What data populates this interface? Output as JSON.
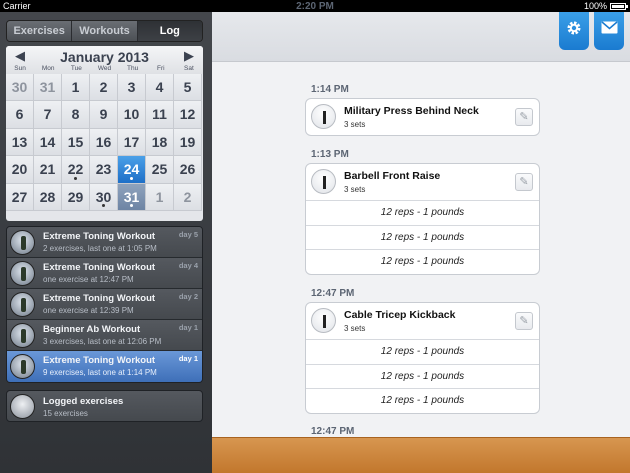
{
  "status": {
    "carrier": "Carrier",
    "time": "2:20 PM",
    "battery": "100%"
  },
  "tabs": [
    {
      "label": "Exercises",
      "active": false
    },
    {
      "label": "Workouts",
      "active": false
    },
    {
      "label": "Log",
      "active": true
    }
  ],
  "calendar": {
    "month": "January 2013",
    "prev": "◀",
    "next": "▶",
    "dows": [
      "Sun",
      "Mon",
      "Tue",
      "Wed",
      "Thu",
      "Fri",
      "Sat"
    ],
    "weeks": [
      [
        {
          "d": "30",
          "other": true
        },
        {
          "d": "31",
          "other": true
        },
        {
          "d": "1"
        },
        {
          "d": "2"
        },
        {
          "d": "3"
        },
        {
          "d": "4"
        },
        {
          "d": "5"
        }
      ],
      [
        {
          "d": "6"
        },
        {
          "d": "7"
        },
        {
          "d": "8"
        },
        {
          "d": "9"
        },
        {
          "d": "10"
        },
        {
          "d": "11"
        },
        {
          "d": "12"
        }
      ],
      [
        {
          "d": "13"
        },
        {
          "d": "14"
        },
        {
          "d": "15"
        },
        {
          "d": "16"
        },
        {
          "d": "17"
        },
        {
          "d": "18"
        },
        {
          "d": "19"
        }
      ],
      [
        {
          "d": "20"
        },
        {
          "d": "21"
        },
        {
          "d": "22",
          "dot": true
        },
        {
          "d": "23"
        },
        {
          "d": "24",
          "dot": true,
          "selected": true
        },
        {
          "d": "25"
        },
        {
          "d": "26"
        }
      ],
      [
        {
          "d": "27"
        },
        {
          "d": "28"
        },
        {
          "d": "29"
        },
        {
          "d": "30",
          "dot": true
        },
        {
          "d": "31",
          "dot": true,
          "today": true
        },
        {
          "d": "1",
          "other": true
        },
        {
          "d": "2",
          "other": true
        }
      ]
    ]
  },
  "workouts": [
    {
      "title": "Extreme Toning Workout",
      "sub": "2 exercises, last one at 1:05 PM",
      "day": "day 5",
      "active": false
    },
    {
      "title": "Extreme Toning Workout",
      "sub": "one exercise at 12:47 PM",
      "day": "day 4",
      "active": false
    },
    {
      "title": "Extreme Toning Workout",
      "sub": "one exercise at 12:39 PM",
      "day": "day 2",
      "active": false
    },
    {
      "title": "Beginner Ab Workout",
      "sub": "3 exercises, last one at 12:06 PM",
      "day": "day 1",
      "active": false
    },
    {
      "title": "Extreme Toning Workout",
      "sub": "9 exercises, last one at 1:14 PM",
      "day": "day 1",
      "active": true
    }
  ],
  "logged": {
    "title": "Logged exercises",
    "sub": "15 exercises"
  },
  "entries": [
    {
      "time": "1:14 PM",
      "name": "Military Press Behind Neck",
      "sets": "3 sets",
      "rows": []
    },
    {
      "time": "1:13 PM",
      "name": "Barbell Front Raise",
      "sets": "3 sets",
      "rows": [
        "12 reps - 1 pounds",
        "12 reps - 1 pounds",
        "12 reps - 1 pounds"
      ]
    },
    {
      "time": "12:47 PM",
      "name": "Cable Tricep Kickback",
      "sets": "3 sets",
      "rows": [
        "12 reps - 1 pounds",
        "12 reps - 1 pounds",
        "12 reps - 1 pounds"
      ]
    },
    {
      "time": "12:47 PM",
      "name": "",
      "sets": "",
      "rows": []
    }
  ],
  "icons": {
    "settings": "gear-icon",
    "mail": "mail-icon",
    "edit": "pencil-icon"
  },
  "colors": {
    "accent": "#1f7fd4",
    "selected_row": "#4a7bc4",
    "bottom_bar": "#c98238"
  }
}
